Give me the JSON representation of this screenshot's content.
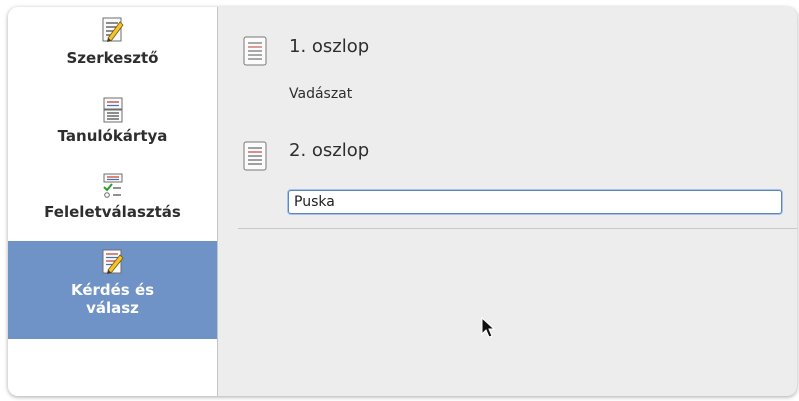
{
  "sidebar": {
    "items": [
      {
        "label": "Szerkesztő",
        "icon": "editor-icon",
        "active": false
      },
      {
        "label": "Tanulókártya",
        "icon": "flashcard-icon",
        "active": false
      },
      {
        "label": "Feleletválasztás",
        "icon": "multiple-choice-icon",
        "active": false
      },
      {
        "label_line1": "Kérdés és",
        "label_line2": "válasz",
        "icon": "question-answer-icon",
        "active": true
      }
    ]
  },
  "main": {
    "column1": {
      "title": "1. oszlop",
      "value": "Vadászat",
      "icon": "document-icon"
    },
    "column2": {
      "title": "2. oszlop",
      "input_value": "Puska",
      "icon": "document-icon"
    }
  },
  "colors": {
    "accent": "#6f93c6",
    "background": "#ededed",
    "sidebar_bg": "#ffffff",
    "text": "#2e2e2e",
    "input_border": "#5b87c0"
  }
}
